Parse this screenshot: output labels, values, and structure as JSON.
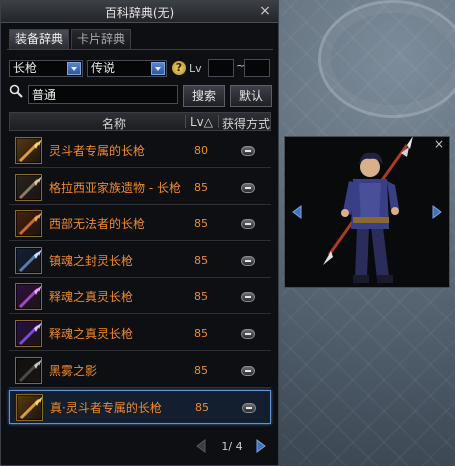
{
  "window": {
    "title": "百科辞典(无)",
    "close_symbol": "×"
  },
  "tabs": [
    {
      "label": "装备辞典",
      "active": true
    },
    {
      "label": "卡片辞典",
      "active": false
    }
  ],
  "filters": {
    "type_value": "长枪",
    "grade_value": "传说",
    "lv_label": "Lv",
    "lv_separator": "~",
    "lv_min": "",
    "lv_max": ""
  },
  "search": {
    "value": "普通",
    "search_button": "搜索",
    "default_button": "默认"
  },
  "table": {
    "headers": {
      "name": "名称",
      "lv": "Lv△",
      "method": "获得方式"
    },
    "rows": [
      {
        "name": "灵斗者专属的长枪",
        "lv": "80",
        "icon": "spear-icon-gold",
        "selected": false
      },
      {
        "name": "格拉西亚家族遗物 - 长枪",
        "lv": "85",
        "icon": "spear-icon-dark",
        "selected": false
      },
      {
        "name": "西部无法者的长枪",
        "lv": "85",
        "icon": "spear-icon-orange",
        "selected": false
      },
      {
        "name": "镇魂之封灵长枪",
        "lv": "85",
        "icon": "spear-icon-blue",
        "selected": false
      },
      {
        "name": "释魂之真灵长枪",
        "lv": "85",
        "icon": "spear-icon-purple",
        "selected": false
      },
      {
        "name": "释魂之真灵长枪",
        "lv": "85",
        "icon": "spear-icon-violet",
        "selected": false
      },
      {
        "name": "黑雾之影",
        "lv": "85",
        "icon": "spear-icon-black",
        "selected": false
      },
      {
        "name": "真·灵斗者专属的长枪",
        "lv": "85",
        "icon": "spear-icon-gold",
        "selected": true
      }
    ]
  },
  "pager": {
    "text": "1/ 4"
  },
  "preview": {
    "close_symbol": "×"
  },
  "colors": {
    "item_name": "#f08a2c",
    "selection_border": "#5e93d8",
    "arrow_blue": "#3f72c4"
  }
}
